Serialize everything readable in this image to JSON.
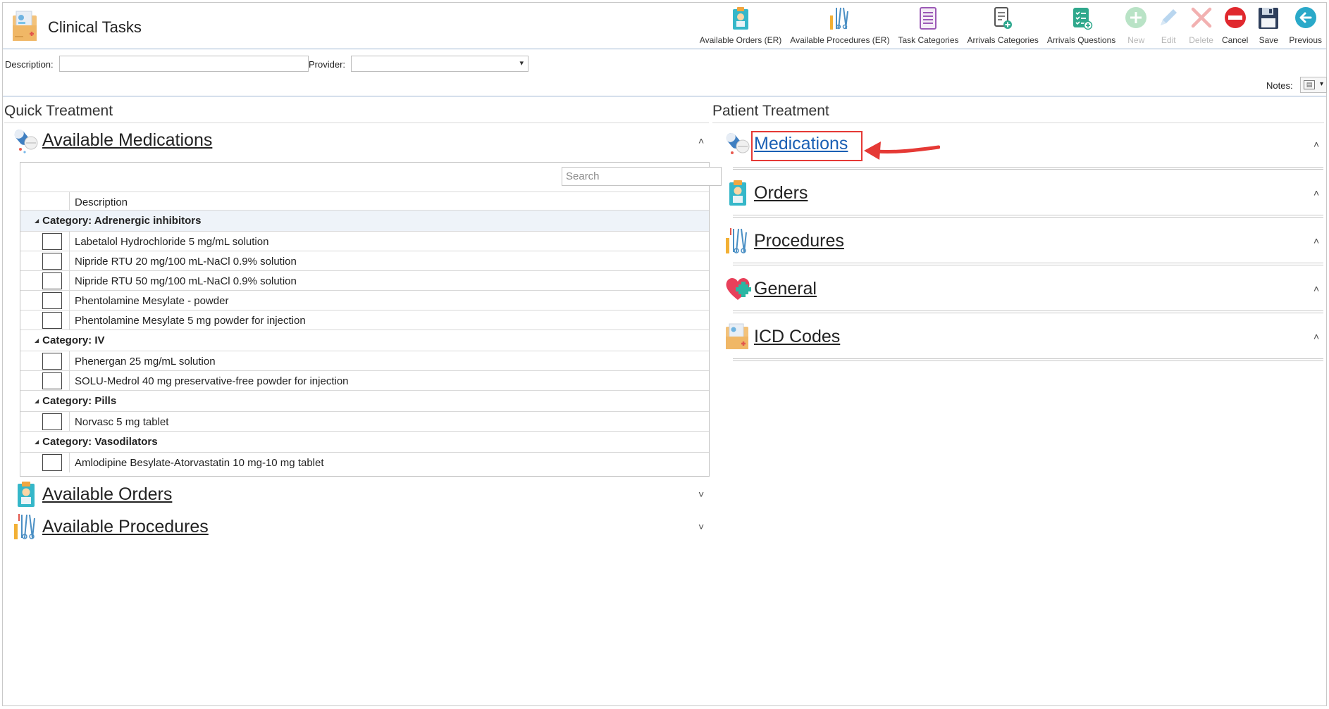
{
  "app": {
    "title": "Clinical Tasks"
  },
  "toolbar": [
    {
      "label": "Available Orders (ER)",
      "icon": "clipboard-doctor-icon",
      "enabled": true
    },
    {
      "label": "Available Procedures (ER)",
      "icon": "surgical-tools-icon",
      "enabled": true
    },
    {
      "label": "Task Categories",
      "icon": "list-document-icon",
      "enabled": true
    },
    {
      "label": "Arrivals Categories",
      "icon": "document-add-icon",
      "enabled": true
    },
    {
      "label": "Arrivals Questions",
      "icon": "checklist-add-icon",
      "enabled": true
    },
    {
      "label": "New",
      "icon": "plus-circle-icon",
      "enabled": false
    },
    {
      "label": "Edit",
      "icon": "pencil-icon",
      "enabled": false
    },
    {
      "label": "Delete",
      "icon": "x-icon",
      "enabled": false
    },
    {
      "label": "Cancel",
      "icon": "no-entry-icon",
      "enabled": true
    },
    {
      "label": "Save",
      "icon": "floppy-disk-icon",
      "enabled": true
    },
    {
      "label": "Previous",
      "icon": "back-arrow-icon",
      "enabled": true
    }
  ],
  "filters": {
    "description_label": "Description:",
    "description_value": "",
    "provider_label": "Provider:",
    "provider_value": ""
  },
  "notes": {
    "label": "Notes:"
  },
  "quick_treatment": {
    "title": "Quick Treatment",
    "medications": {
      "title": "Available Medications",
      "search_placeholder": "Search",
      "column_header": "Description",
      "categories": [
        {
          "name": "Category: Adrenergic inhibitors",
          "items": [
            "Labetalol Hydrochloride 5 mg/mL solution",
            "Nipride RTU 20 mg/100 mL-NaCl 0.9% solution",
            "Nipride RTU 50 mg/100 mL-NaCl 0.9% solution",
            "Phentolamine Mesylate - powder",
            "Phentolamine Mesylate 5 mg powder for injection"
          ]
        },
        {
          "name": "Category: IV",
          "items": [
            "Phenergan 25 mg/mL solution",
            "SOLU-Medrol 40 mg preservative-free powder for injection"
          ]
        },
        {
          "name": "Category: Pills",
          "items": [
            "Norvasc 5 mg tablet"
          ]
        },
        {
          "name": "Category: Vasodilators",
          "items": [
            "Amlodipine Besylate-Atorvastatin 10 mg-10 mg tablet"
          ]
        }
      ]
    },
    "orders": {
      "title": "Available Orders"
    },
    "procedures": {
      "title": "Available Procedures"
    }
  },
  "patient_treatment": {
    "title": "Patient Treatment",
    "sections": [
      {
        "title": "Medications",
        "icon": "pills-icon"
      },
      {
        "title": "Orders",
        "icon": "clipboard-doctor-icon"
      },
      {
        "title": "Procedures",
        "icon": "surgical-tools-icon"
      },
      {
        "title": "General",
        "icon": "heart-plus-icon"
      },
      {
        "title": "ICD Codes",
        "icon": "medical-folder-icon"
      }
    ]
  },
  "glyphs": {
    "collapse": "˄",
    "expand": "˅",
    "triangle": "◢",
    "caret": "▾"
  },
  "colors": {
    "accent_link": "#1a5fb4",
    "highlight": "#e53935",
    "divider": "#9fb7d3"
  }
}
